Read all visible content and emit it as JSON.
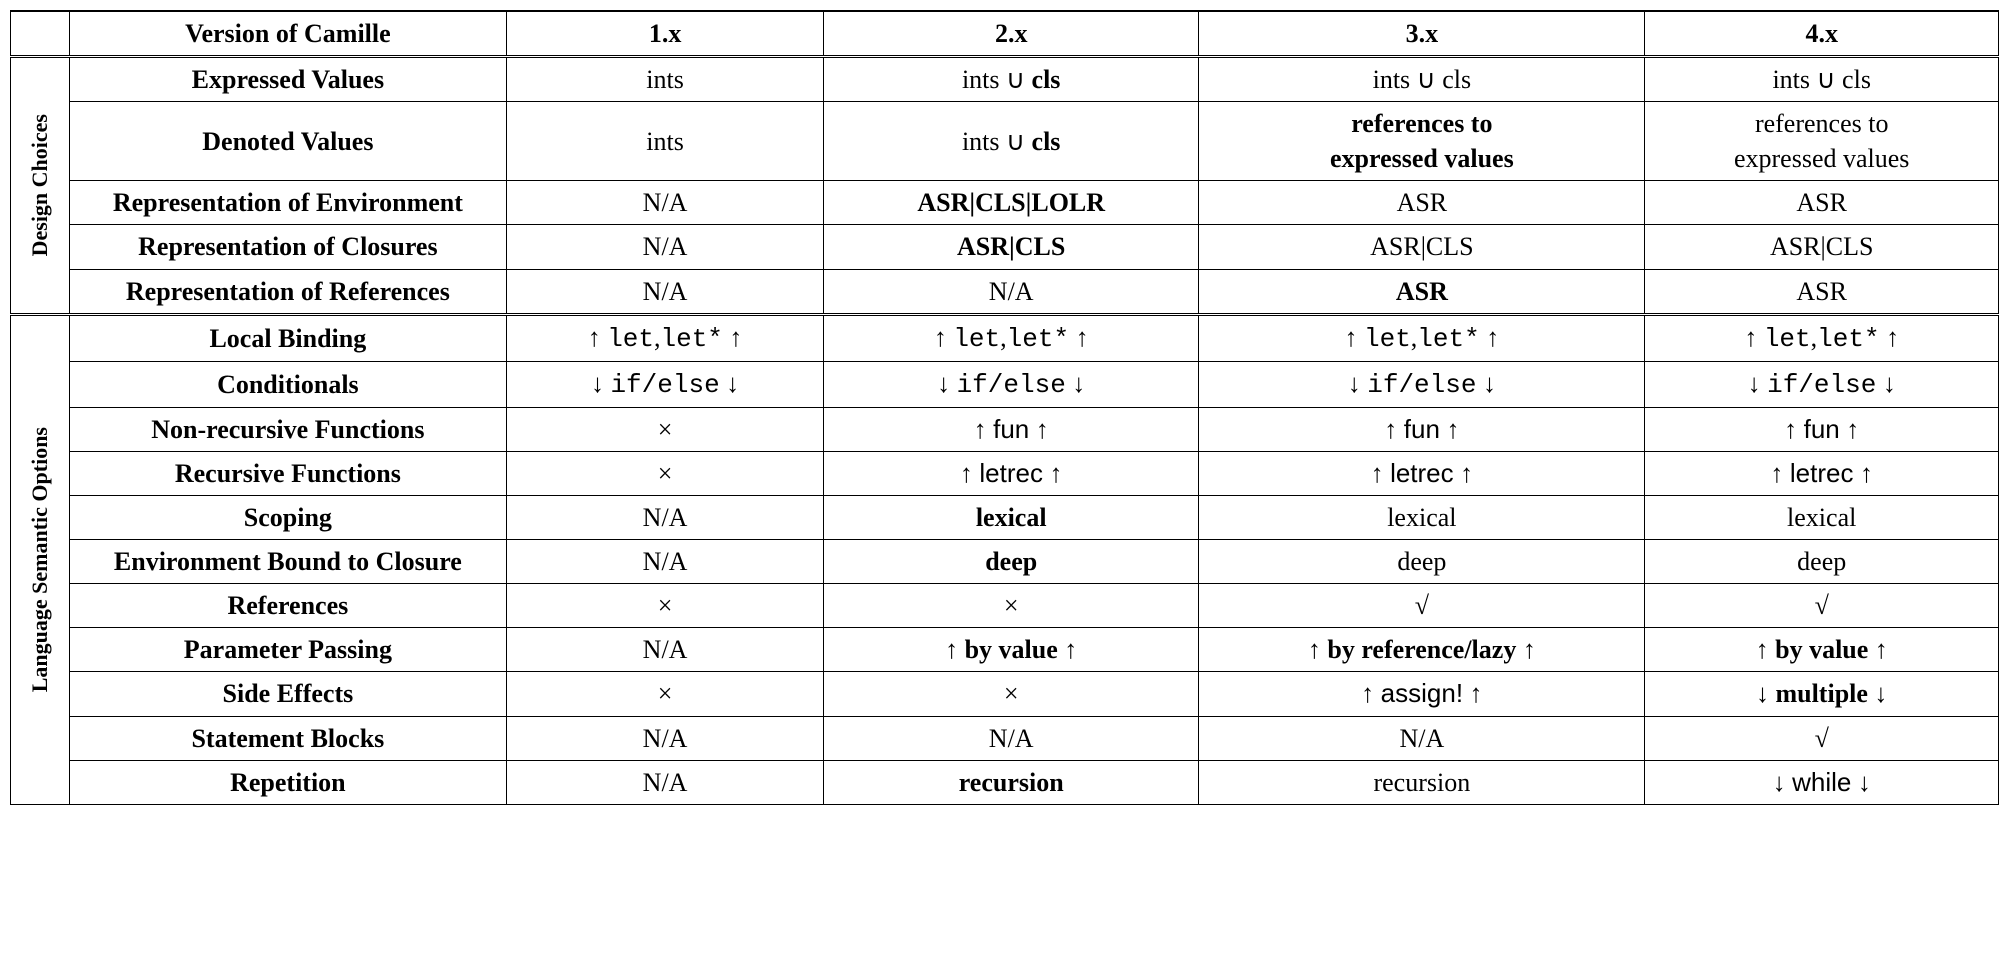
{
  "header": {
    "title": "Version of Camille",
    "v1": "1.x",
    "v2": "2.x",
    "v3": "3.x",
    "v4": "4.x"
  },
  "groups": {
    "design": "Design Choices",
    "semantic": "Language Semantic Options"
  },
  "design": {
    "expressed": {
      "label": "Expressed Values",
      "v1": "ints",
      "v2_pre": "ints ∪ ",
      "v2_cls": "cls",
      "v3": "ints ∪ cls",
      "v4": "ints ∪ cls"
    },
    "denoted": {
      "label": "Denoted Values",
      "v1": "ints",
      "v2_pre": "ints ∪ ",
      "v2_cls": "cls",
      "v3a": "references to",
      "v3b": "expressed values",
      "v4a": "references to",
      "v4b": "expressed values"
    },
    "env": {
      "label": "Representation of Environment",
      "v1": "N/A",
      "v2": "ASR|CLS|LOLR",
      "v3": "ASR",
      "v4": "ASR"
    },
    "closures": {
      "label": "Representation of Closures",
      "v1": "N/A",
      "v2": "ASR|CLS",
      "v3": "ASR|CLS",
      "v4": "ASR|CLS"
    },
    "refs": {
      "label": "Representation of References",
      "v1": "N/A",
      "v2": "N/A",
      "v3": "ASR",
      "v4": "ASR"
    }
  },
  "semantic": {
    "local": {
      "label": "Local Binding",
      "up": "↑ ",
      "up2": " ↑",
      "let": "let",
      "comma": ",",
      "letstar": "let*"
    },
    "cond": {
      "label": "Conditionals",
      "dn": "↓ ",
      "dn2": " ↓",
      "ifelse": "if/else"
    },
    "nonrec": {
      "label": "Non-recursive Functions",
      "v1": "×",
      "up": "↑ ",
      "up2": " ↑",
      "fun": "fun"
    },
    "rec": {
      "label": "Recursive Functions",
      "v1": "×",
      "up": "↑ ",
      "up2": " ↑",
      "letrec": "letrec"
    },
    "scoping": {
      "label": "Scoping",
      "v1": "N/A",
      "v2": "lexical",
      "v3": "lexical",
      "v4": "lexical"
    },
    "envbound": {
      "label": "Environment Bound to Closure",
      "v1": "N/A",
      "v2": "deep",
      "v3": "deep",
      "v4": "deep"
    },
    "references": {
      "label": "References",
      "v1": "×",
      "v2": "×",
      "v3": "√",
      "v4": "√"
    },
    "param": {
      "label": "Parameter Passing",
      "v1": "N/A",
      "up": "↑ ",
      "up2": " ↑",
      "byval": "by value",
      "byref": "by reference/lazy"
    },
    "side": {
      "label": "Side Effects",
      "v1": "×",
      "v2": "×",
      "up": "↑ ",
      "up2": " ↑",
      "dn": "↓ ",
      "dn2": " ↓",
      "assign": "assign!",
      "multiple": "multiple"
    },
    "stmt": {
      "label": "Statement Blocks",
      "v1": "N/A",
      "v2": "N/A",
      "v3": "N/A",
      "v4": "√"
    },
    "rep": {
      "label": "Repetition",
      "v1": "N/A",
      "v2": "recursion",
      "v3": "recursion",
      "dn": "↓ ",
      "dn2": " ↓",
      "while": "while"
    }
  }
}
